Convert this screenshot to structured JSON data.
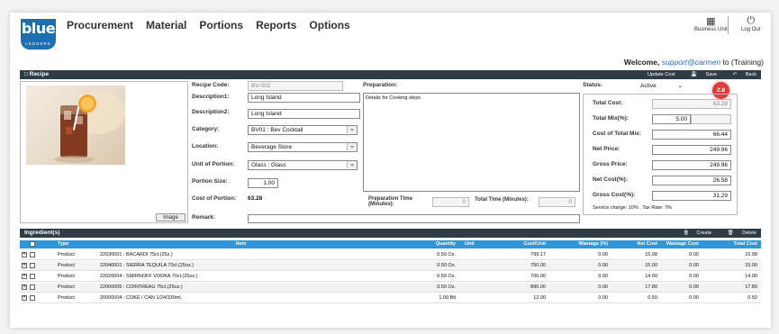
{
  "brand": {
    "logo_text": "blue",
    "logo_sub": "LEDGERS"
  },
  "nav": [
    "Procurement",
    "Material",
    "Portions",
    "Reports",
    "Options"
  ],
  "header": {
    "business_unit": "Business Unit",
    "log_out": "Log Out"
  },
  "welcome": {
    "prefix": "Welcome,",
    "user": "support@carmen",
    "suffix": "to (Training)"
  },
  "recipe_bar": {
    "title": "Recipe",
    "update_cost": "Update Cost",
    "save": "Save",
    "back": "Back"
  },
  "badge": "2.8",
  "form": {
    "recipe_code_label": "Recipe Code:",
    "recipe_code": "BV-002",
    "desc1_label": "Description1:",
    "desc1": "Long Island",
    "desc2_label": "Description2:",
    "desc2": "Long Island",
    "category_label": "Category:",
    "category": "BV01 : Bev Cocktail",
    "location_label": "Location:",
    "location": "Beverage Store",
    "unit_label": "Unit of Portion:",
    "unit": "Glass : Glass",
    "portion_size_label": "Portion Size:",
    "portion_size": "1.00",
    "cost_portion_label": "Cost of Portion:",
    "cost_portion": "63.28",
    "remark_label": "Remark:",
    "image_button": "Image",
    "preparation_label": "Preparation:",
    "preparation": "Details for Cooking steps",
    "prep_time_label_1": "Preparation Time",
    "prep_time_label_2": "(Minutes):",
    "prep_time": "0",
    "total_time_label": "Total Time (Minutes):",
    "total_time": "0",
    "status_label": "Status:",
    "status": "Active"
  },
  "summary": {
    "total_cost_label": "Total Cost:",
    "total_cost": "63.28",
    "total_mix_label": "Total Mix(%):",
    "total_mix": "5.00",
    "cost_total_mix_label": "Cost of Total Mix:",
    "cost_total_mix": "66.44",
    "net_price_label": "Net Price:",
    "net_price": "249.96",
    "gross_price_label": "Gross Price:",
    "gross_price": "249.96",
    "net_cost_label": "Net Cost(%):",
    "net_cost": "26.58",
    "gross_cost_label": "Gross Cost(%):",
    "gross_cost": "31.29",
    "note": "Service charge: 10% , Tax Rate: 7%"
  },
  "ingredients_bar": {
    "title": "Ingredient(s)",
    "create": "Create",
    "delete": "Delete"
  },
  "table": {
    "headers": [
      "Type",
      "Item",
      "Quantity",
      "Unit",
      "Cost/Unit",
      "Wastage (%)",
      "Net Cost",
      "Wastage Cost",
      "Total Cost"
    ],
    "rows": [
      {
        "type": "Product",
        "item": "22030001 : BACARDI 75cl.(25z.)",
        "qty": "0.50 Oz.",
        "unit": "",
        "cost_unit": "799.17",
        "wastage": "0.00",
        "net": "15.98",
        "wcost": "0.00",
        "total": "15.98"
      },
      {
        "type": "Product",
        "item": "22040001 : SIERRA TEQUILA 70cl.(25oz.)",
        "qty": "0.50 Oz.",
        "unit": "",
        "cost_unit": "750.00",
        "wastage": "0.00",
        "net": "15.00",
        "wcost": "0.00",
        "total": "15.00"
      },
      {
        "type": "Product",
        "item": "22020004 : SMIRNOFF VODKA 70cl.(25oz.)",
        "qty": "0.50 Oz.",
        "unit": "",
        "cost_unit": "700.00",
        "wastage": "0.00",
        "net": "14.00",
        "wcost": "0.00",
        "total": "14.00"
      },
      {
        "type": "Product",
        "item": "22000005 : COINTREAU 75cl.(25oz.)",
        "qty": "0.50 Oz.",
        "unit": "",
        "cost_unit": "890.00",
        "wastage": "0.00",
        "net": "17.80",
        "wcost": "0.00",
        "total": "17.80"
      },
      {
        "type": "Product",
        "item": "20000004 : COKE / CAN 1/24/330ml.",
        "qty": "1.00 Btl",
        "unit": "",
        "cost_unit": "12.00",
        "wastage": "0.00",
        "net": "0.50",
        "wcost": "0.00",
        "total": "0.50"
      }
    ]
  }
}
